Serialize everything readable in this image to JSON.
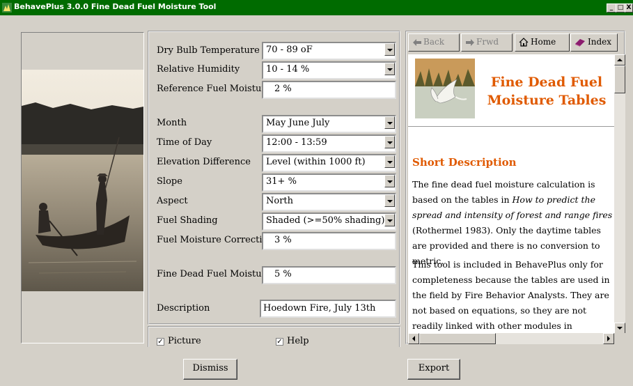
{
  "window": {
    "title": "BehavePlus 3.0.0 Fine Dead Fuel Moisture Tool",
    "controls": [
      "_",
      "□",
      "X"
    ]
  },
  "form": {
    "dry_bulb": {
      "label": "Dry Bulb Temperature",
      "value": "70 - 89 oF"
    },
    "humidity": {
      "label": "Relative Humidity",
      "value": "10 - 14 %"
    },
    "ref_moisture": {
      "label": "Reference Fuel Moisture",
      "value": "2 %"
    },
    "month": {
      "label": "Month",
      "value": "May June July"
    },
    "time": {
      "label": "Time of Day",
      "value": "12:00 - 13:59"
    },
    "elevation": {
      "label": "Elevation Difference",
      "value": "Level (within 1000 ft)"
    },
    "slope": {
      "label": "Slope",
      "value": "31+ %"
    },
    "aspect": {
      "label": "Aspect",
      "value": "North"
    },
    "shading": {
      "label": "Fuel Shading",
      "value": "Shaded (>=50% shading)"
    },
    "correction": {
      "label": "Fuel Moisture Correction",
      "value": "3 %"
    },
    "fine_dead": {
      "label": "Fine Dead Fuel Moisture",
      "value": "5 %"
    },
    "description": {
      "label": "Description",
      "value": "Hoedown Fire, July 13th"
    }
  },
  "options": {
    "picture": {
      "label": "Picture",
      "checked": true
    },
    "help": {
      "label": "Help",
      "checked": true
    }
  },
  "help_nav": {
    "back": "Back",
    "forward": "Frwd",
    "home": "Home",
    "index": "Index"
  },
  "help": {
    "title_line1": "Fine Dead Fuel",
    "title_line2": "Moisture Tables",
    "heading": "Short Description",
    "p1_a": "The fine dead fuel moisture calculation is based on the tables in ",
    "p1_italic": "How to predict the spread and intensity of forest and range fires",
    "p1_b": " (Rothermel 1983). Only the daytime tables are provided and there is no conversion to metric.",
    "p2": "This tool is included in BehavePlus only for completeness because the tables are used in the field by Fire Behavior Analysts. They are not based on equations, so they are not readily linked with other modules in BehavePlus."
  },
  "buttons": {
    "dismiss": "Dismiss",
    "export": "Export"
  },
  "colors": {
    "titlebar": "#006b00",
    "help_accent": "#e05a00",
    "face": "#d4d0c8"
  }
}
